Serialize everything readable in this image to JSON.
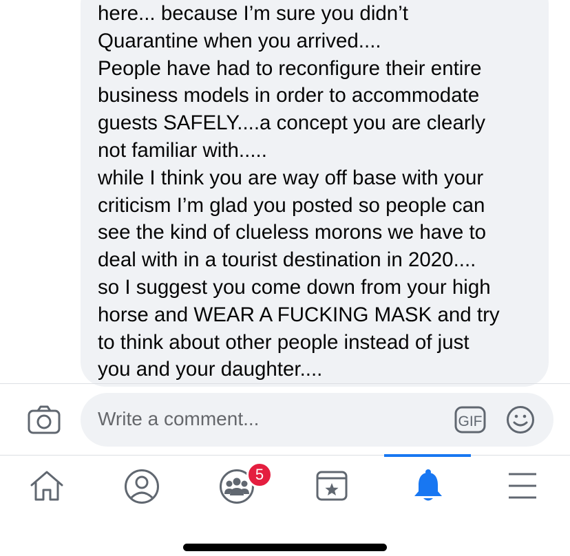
{
  "comment": {
    "text": "here... because I’m sure you didn’t\nQuarantine when you arrived....\nPeople have had to reconfigure their entire\nbusiness models in order to accommodate\nguests SAFELY....a concept you are clearly\nnot familiar with.....\nwhile I think you are way off base with your\ncriticism I’m glad you posted so people can\nsee the kind of clueless morons we have to\ndeal with in a tourist destination in 2020....\nso I suggest you come down from your high\nhorse and WEAR A FUCKING MASK and try\nto think about other people instead of just\nyou and your daughter...."
  },
  "composer": {
    "placeholder": "Write a comment...",
    "gif_label": "GIF",
    "camera_icon": "camera-icon",
    "emoji_icon": "smiley-icon"
  },
  "nav": {
    "items": [
      {
        "icon": "home-icon",
        "active": false
      },
      {
        "icon": "profile-icon",
        "active": false
      },
      {
        "icon": "groups-icon",
        "active": false,
        "badge": "5"
      },
      {
        "icon": "marketplace-icon",
        "active": false
      },
      {
        "icon": "bell-icon",
        "active": true
      },
      {
        "icon": "menu-icon",
        "active": false
      }
    ]
  },
  "colors": {
    "accent": "#1877f2",
    "badge": "#e41e3f",
    "bubble": "#f0f2f5",
    "icon": "#606770"
  }
}
